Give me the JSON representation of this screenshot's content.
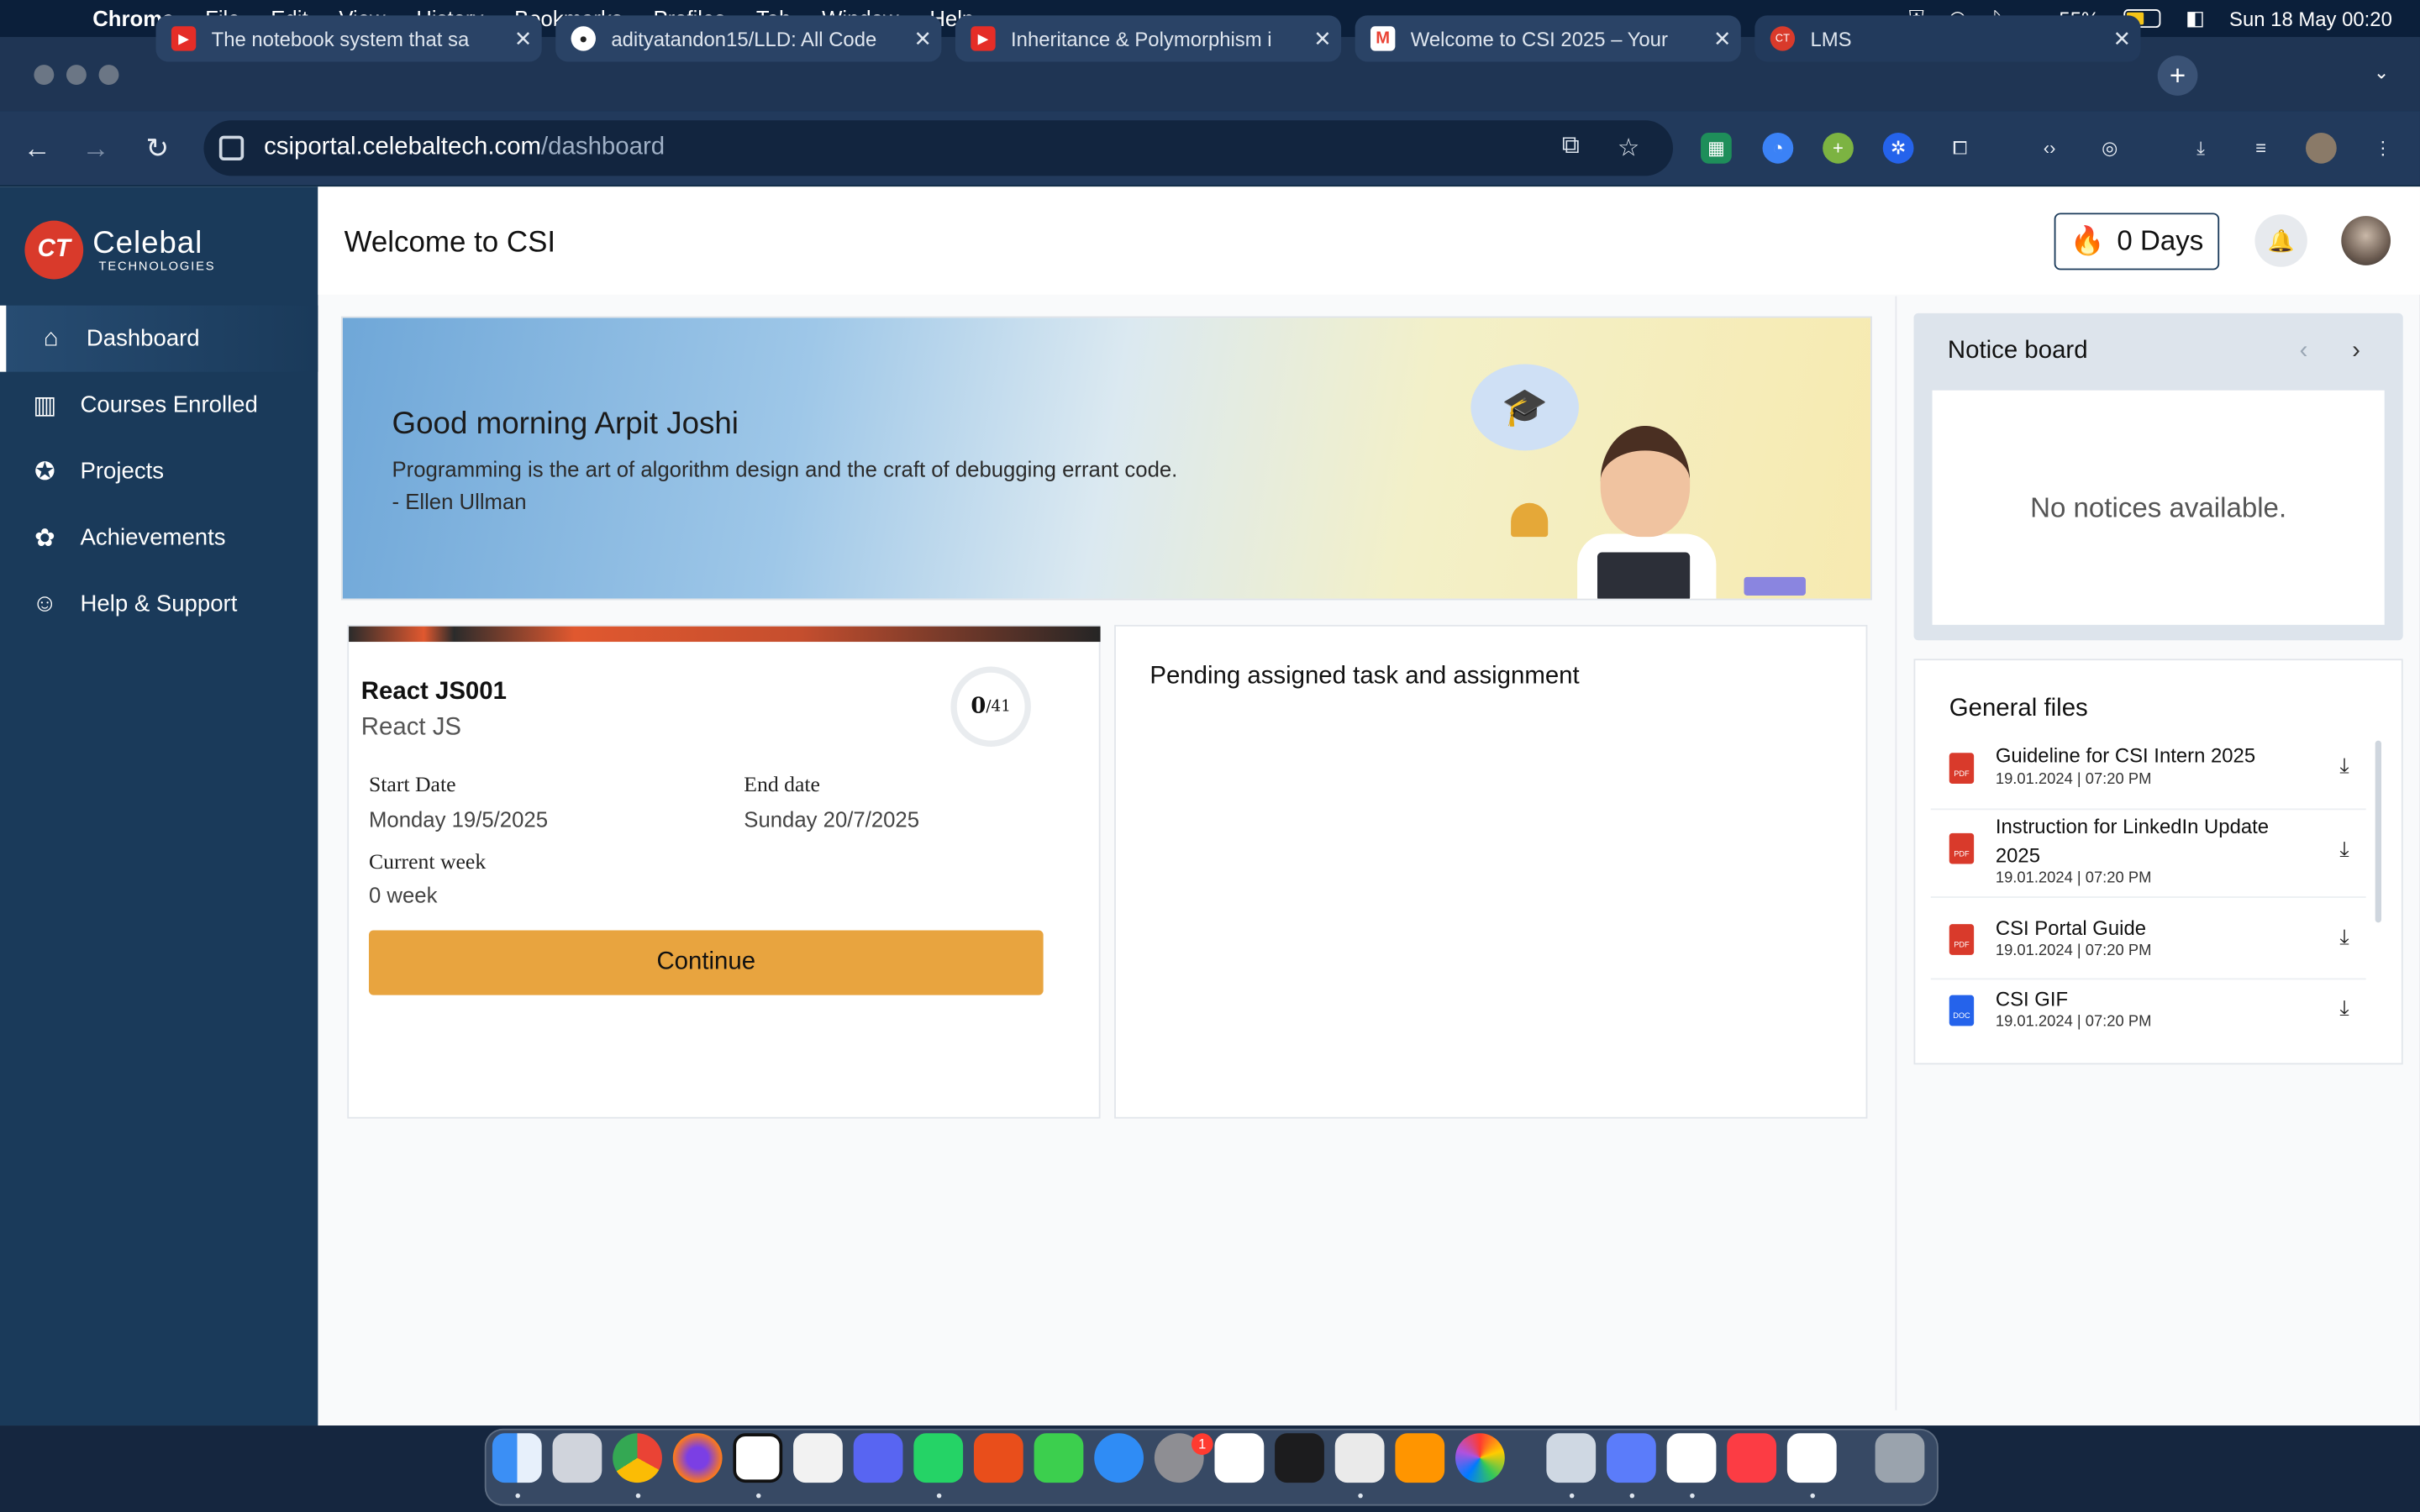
{
  "menubar": {
    "app": "Chrome",
    "items": [
      "File",
      "Edit",
      "View",
      "History",
      "Bookmarks",
      "Profiles",
      "Tab",
      "Window",
      "Help"
    ],
    "battery": "55%",
    "battery_level": 0.55,
    "datetime": "Sun 18 May  00:20"
  },
  "tabs": [
    {
      "title": "The notebook system that sa",
      "favicon": "youtube-icon",
      "color": "#e52d27"
    },
    {
      "title": "adityatandon15/LLD: All Code",
      "favicon": "github-icon",
      "color": "#ffffff"
    },
    {
      "title": "Inheritance & Polymorphism i",
      "favicon": "youtube-icon",
      "color": "#e52d27"
    },
    {
      "title": "Welcome to CSI 2025 – Your",
      "favicon": "gmail-icon",
      "color": "#ea4335"
    },
    {
      "title": "LMS",
      "favicon": "celebal-icon",
      "color": "#d93a2b"
    }
  ],
  "address": {
    "host": "csiportal.celebaltech.com",
    "path": "/dashboard"
  },
  "sidebar": {
    "logo_main": "Celebal",
    "logo_sub": "TECHNOLOGIES",
    "logo_mark": "CT",
    "items": [
      {
        "label": "Dashboard",
        "icon": "home-icon"
      },
      {
        "label": "Courses Enrolled",
        "icon": "book-icon"
      },
      {
        "label": "Projects",
        "icon": "lightbulb-icon"
      },
      {
        "label": "Achievements",
        "icon": "award-icon"
      },
      {
        "label": "Help & Support",
        "icon": "support-icon"
      }
    ]
  },
  "header": {
    "title": "Welcome to CSI",
    "streak": "0 Days"
  },
  "banner": {
    "greeting": "Good morning Arpit Joshi",
    "quote": "Programming is the art of algorithm design and the craft of debugging errant code.",
    "author": "- Ellen Ullman"
  },
  "course": {
    "code": "React JS001",
    "name": "React JS",
    "progress_done": "0",
    "progress_total": "/41",
    "start_label": "Start Date",
    "start_value": "Monday 19/5/2025",
    "end_label": "End date",
    "end_value": "Sunday 20/7/2025",
    "week_label": "Current week",
    "week_value": "0 week",
    "continue_label": "Continue"
  },
  "pending": {
    "title": "Pending assigned task and assignment"
  },
  "notice": {
    "title": "Notice board",
    "empty": "No notices available."
  },
  "files": {
    "title": "General files",
    "items": [
      {
        "name": "Guideline for CSI Intern 2025",
        "date": "19.01.2024 | 07:20 PM",
        "type": "PDF"
      },
      {
        "name": "Instruction for LinkedIn Update 2025",
        "date": "19.01.2024 | 07:20 PM",
        "type": "PDF"
      },
      {
        "name": "CSI Portal Guide",
        "date": "19.01.2024 | 07:20 PM",
        "type": "PDF"
      },
      {
        "name": "CSI GIF",
        "date": "19.01.2024 | 07:20 PM",
        "type": "DOC"
      }
    ]
  },
  "dock": {
    "badge": "1"
  }
}
